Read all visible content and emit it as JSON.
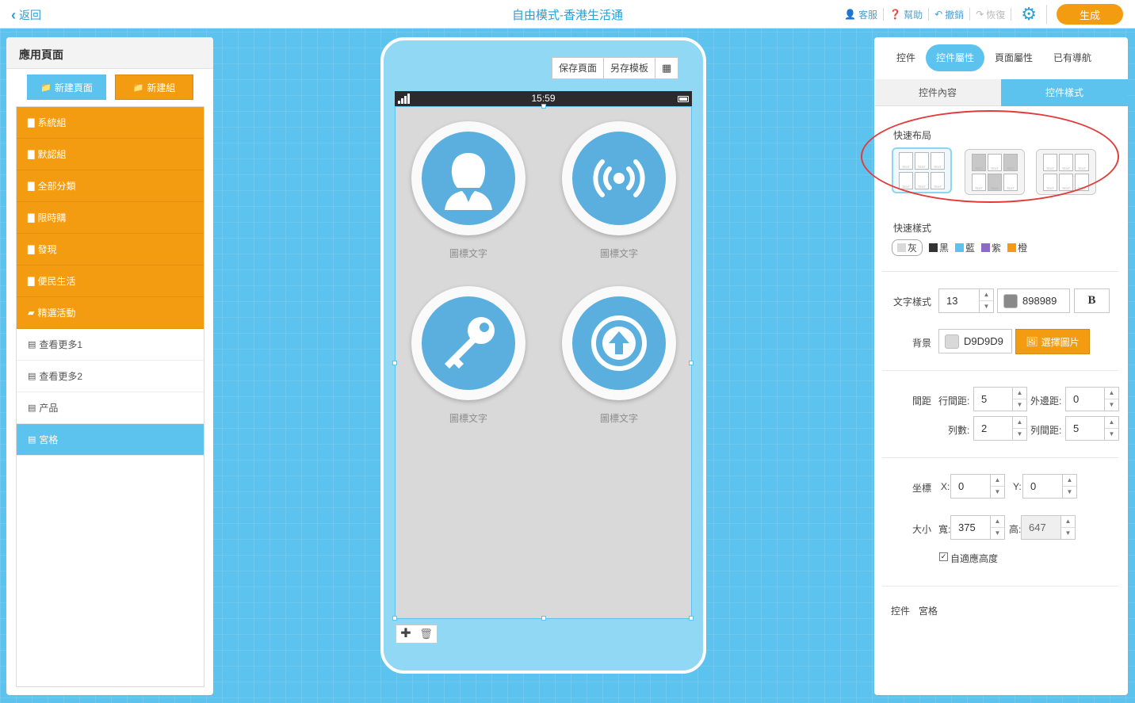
{
  "topbar": {
    "back_label": "返回",
    "title": "自由模式-香港生活通",
    "actions": {
      "service": "客服",
      "help": "幫助",
      "undo": "撤銷",
      "redo": "恢復"
    },
    "generate_label": "生成"
  },
  "left_panel": {
    "title": "應用頁面",
    "new_page_label": "新建頁面",
    "new_group_label": "新建組",
    "items": [
      {
        "label": "系統組",
        "type": "group"
      },
      {
        "label": "默認組",
        "type": "group"
      },
      {
        "label": "全部分類",
        "type": "group"
      },
      {
        "label": "限時購",
        "type": "group"
      },
      {
        "label": "發現",
        "type": "group"
      },
      {
        "label": "便民生活",
        "type": "group"
      },
      {
        "label": "精選活動",
        "type": "group",
        "open": true
      },
      {
        "label": "查看更多1",
        "type": "page"
      },
      {
        "label": "查看更多2",
        "type": "page"
      },
      {
        "label": "产品",
        "type": "page"
      },
      {
        "label": "宮格",
        "type": "page",
        "active": true
      }
    ]
  },
  "phone": {
    "tools": {
      "save_page": "保存頁面",
      "save_template": "另存模板"
    },
    "status_time": "15:59",
    "cells": [
      {
        "label": "圖標文字",
        "icon": "user-icon"
      },
      {
        "label": "圖標文字",
        "icon": "broadcast-icon"
      },
      {
        "label": "圖標文字",
        "icon": "key-icon"
      },
      {
        "label": "圖標文字",
        "icon": "upload-arrow-icon"
      }
    ]
  },
  "right_panel": {
    "tabs": [
      "控件",
      "控件屬性",
      "頁面屬性",
      "已有導航"
    ],
    "active_tab": "控件屬性",
    "subtabs": [
      "控件內容",
      "控件樣式"
    ],
    "active_subtab": "控件樣式",
    "quick_layout_title": "快速布局",
    "layout_cell_text": "TEXT",
    "quick_style_title": "快速樣式",
    "style_swatches": [
      {
        "label": "灰",
        "color": "#d9d9d9"
      },
      {
        "label": "黑",
        "color": "#333333"
      },
      {
        "label": "藍",
        "color": "#5cc3ef"
      },
      {
        "label": "紫",
        "color": "#8e6ac8"
      },
      {
        "label": "橙",
        "color": "#f39c12"
      }
    ],
    "text_style": {
      "label": "文字樣式",
      "font_size": "13",
      "color_value": "898989",
      "color": "#898989",
      "bold_label": "B"
    },
    "background": {
      "label": "背景",
      "color_value": "D9D9D9",
      "color": "#d9d9d9",
      "choose_image_label": "選擇圖片"
    },
    "spacing": {
      "label": "間距",
      "row_gap_label": "行間距:",
      "row_gap": "5",
      "outer_margin_label": "外邊距:",
      "outer_margin": "0",
      "columns_label": "列數:",
      "columns": "2",
      "col_gap_label": "列間距:",
      "col_gap": "5"
    },
    "position": {
      "label": "坐標",
      "x_label": "X:",
      "x": "0",
      "y_label": "Y:",
      "y": "0"
    },
    "size": {
      "label": "大小",
      "width_label": "寬:",
      "width": "375",
      "height_label": "高:",
      "height": "647",
      "auto_height_label": "自適應高度",
      "auto_height_checked": true
    },
    "control": {
      "label": "控件",
      "value": "宮格"
    }
  }
}
